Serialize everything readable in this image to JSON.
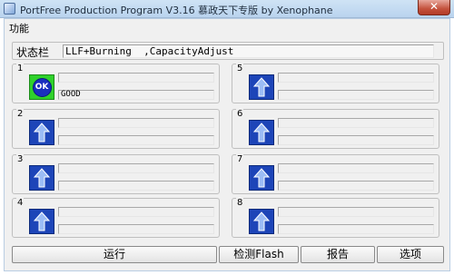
{
  "window": {
    "title": "PortFree Production Program V3.16 慕政天下专版 by Xenophane",
    "close_glyph": "✕"
  },
  "menu": {
    "items": [
      "功能"
    ]
  },
  "status": {
    "label": "状态栏",
    "value": "LLF+Burning  ,CapacityAdjust"
  },
  "ports": [
    {
      "number": "1",
      "state": "ok",
      "icon_text": "OK",
      "bar1": "",
      "bar2": "GOOD"
    },
    {
      "number": "2",
      "state": "idle",
      "icon_text": "",
      "bar1": "",
      "bar2": ""
    },
    {
      "number": "3",
      "state": "idle",
      "icon_text": "",
      "bar1": "",
      "bar2": ""
    },
    {
      "number": "4",
      "state": "idle",
      "icon_text": "",
      "bar1": "",
      "bar2": ""
    },
    {
      "number": "5",
      "state": "idle",
      "icon_text": "",
      "bar1": "",
      "bar2": ""
    },
    {
      "number": "6",
      "state": "idle",
      "icon_text": "",
      "bar1": "",
      "bar2": ""
    },
    {
      "number": "7",
      "state": "idle",
      "icon_text": "",
      "bar1": "",
      "bar2": ""
    },
    {
      "number": "8",
      "state": "idle",
      "icon_text": "",
      "bar1": "",
      "bar2": ""
    }
  ],
  "buttons": {
    "run": "运行",
    "detect_flash": "检测Flash",
    "report": "报告",
    "options": "选项"
  },
  "colors": {
    "ok_icon_bg": "#2fd12b",
    "ok_disc": "#1a2fbf",
    "idle_icon_bg": "#1d45b8"
  }
}
